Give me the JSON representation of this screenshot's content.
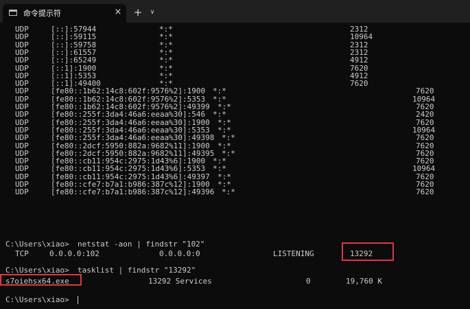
{
  "tab": {
    "title": "命令提示符",
    "close": "×",
    "new_tab": "+",
    "dropdown": "∨"
  },
  "rows": [
    [
      "UDP",
      "[::]:57944",
      "*:*",
      "2312"
    ],
    [
      "UDP",
      "[::]:59115",
      "*:*",
      "10964"
    ],
    [
      "UDP",
      "[::]:59758",
      "*:*",
      "2312"
    ],
    [
      "UDP",
      "[::]:61557",
      "*:*",
      "2312"
    ],
    [
      "UDP",
      "[::]:65249",
      "*:*",
      "4912"
    ],
    [
      "UDP",
      "[::1]:1900",
      "*:*",
      "7620"
    ],
    [
      "UDP",
      "[::1]:5353",
      "*:*",
      "4912"
    ],
    [
      "UDP",
      "[::1]:49400",
      "*:*",
      "7620"
    ],
    [
      "UDP",
      "[fe80::1b62:14c8:602f:9576%2]:1900",
      "*:*",
      "7620"
    ],
    [
      "UDP",
      "[fe80::1b62:14c8:602f:9576%2]:5353",
      "*:*",
      "10964"
    ],
    [
      "UDP",
      "[fe80::1b62:14c8:602f:9576%2]:49399",
      "*:*",
      "7620"
    ],
    [
      "UDP",
      "[fe80::255f:3da4:46a6:eeaa%30]:546",
      "*:*",
      "2420"
    ],
    [
      "UDP",
      "[fe80::255f:3da4:46a6:eeaa%30]:1900",
      "*:*",
      "7620"
    ],
    [
      "UDP",
      "[fe80::255f:3da4:46a6:eeaa%30]:5353",
      "*:*",
      "10964"
    ],
    [
      "UDP",
      "[fe80::255f:3da4:46a6:eeaa%30]:49398",
      "*:*",
      "7620"
    ],
    [
      "UDP",
      "[fe80::2dcf:5950:882a:9682%11]:1900",
      "*:*",
      "7620"
    ],
    [
      "UDP",
      "[fe80::2dcf:5950:882a:9682%11]:49395",
      "*:*",
      "7620"
    ],
    [
      "UDP",
      "[fe80::cb11:954c:2975:1d43%6]:1900",
      "*:*",
      "7620"
    ],
    [
      "UDP",
      "[fe80::cb11:954c:2975:1d43%6]:5353",
      "*:*",
      "10964"
    ],
    [
      "UDP",
      "[fe80::cb11:954c:2975:1d43%6]:49397",
      "*:*",
      "7620"
    ],
    [
      "UDP",
      "[fe80::cfe7:b7a1:b986:387c%12]:1900",
      "*:*",
      "7620"
    ],
    [
      "UDP",
      "[fe80::cfe7:b7a1:b986:387c%12]:49396",
      "*:*",
      "7620"
    ]
  ],
  "cmd1": {
    "prompt": "C:\\Users\\xiao>",
    "command": "netstat -aon | findstr \"102\"",
    "result": {
      "proto": "TCP",
      "local": "0.0.0.0:102",
      "foreign": "0.0.0.0:0",
      "state": "LISTENING",
      "pid": "13292"
    }
  },
  "cmd2": {
    "prompt": "C:\\Users\\xiao>",
    "command": "tasklist | findstr \"13292\"",
    "result": {
      "image": "s7oiehsx64.exe",
      "pid_session": "13292 Services",
      "session_num": "0",
      "mem": "19,760 K"
    }
  },
  "final_prompt": "C:\\Users\\xiao>",
  "colors": {
    "background": "#0c0c0c",
    "text": "#cccccc",
    "titlebar": "#202020",
    "highlight": "#e0383f"
  }
}
